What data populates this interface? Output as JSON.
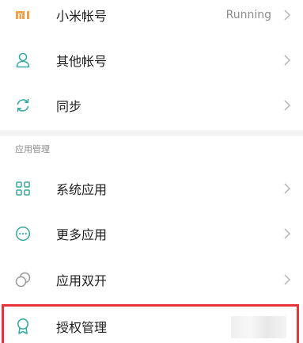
{
  "account_section": {
    "items": [
      {
        "label": "小米帐号",
        "value": "Running",
        "icon": "mi-logo-icon"
      },
      {
        "label": "其他帐号",
        "icon": "person-icon"
      },
      {
        "label": "同步",
        "icon": "sync-icon"
      }
    ]
  },
  "app_section": {
    "header": "应用管理",
    "items": [
      {
        "label": "系统应用",
        "icon": "grid-icon"
      },
      {
        "label": "更多应用",
        "icon": "more-dots-icon"
      },
      {
        "label": "应用双开",
        "icon": "dual-app-icon"
      },
      {
        "label": "授权管理",
        "icon": "badge-icon"
      }
    ]
  },
  "colors": {
    "mi_orange": "#f5a04a",
    "icon_teal": "#3aa9a1",
    "highlight_red": "#e8333b"
  }
}
